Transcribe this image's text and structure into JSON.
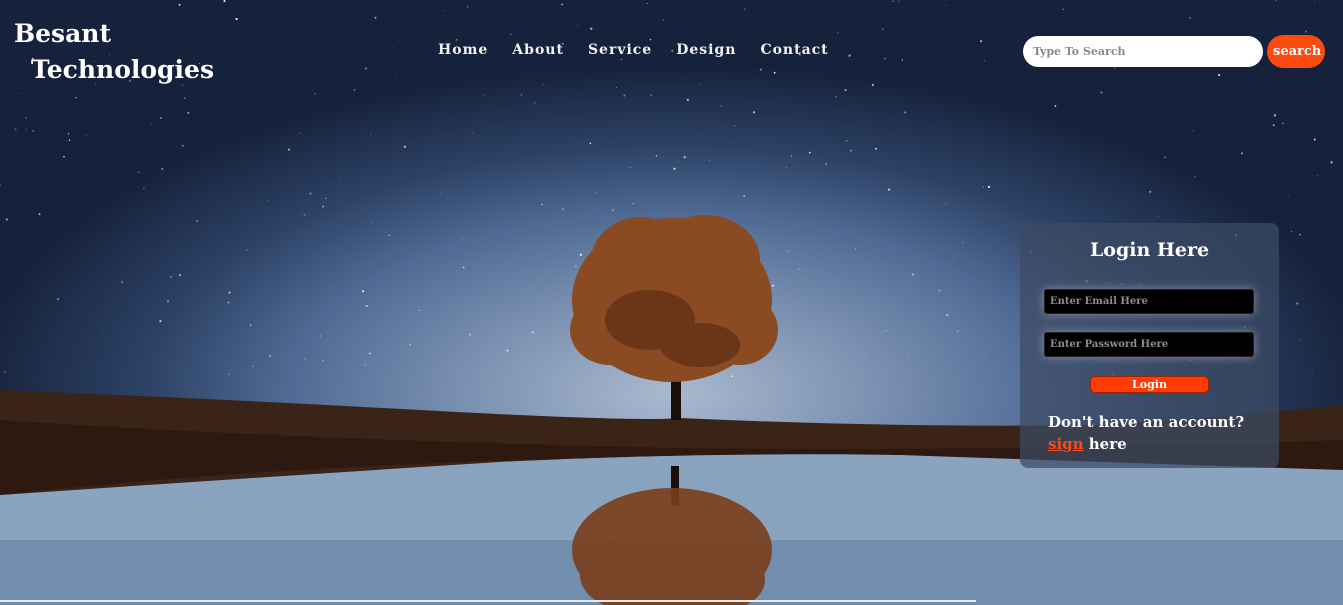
{
  "brand": {
    "line1": "Besant",
    "line2": "Technologies"
  },
  "nav": {
    "items": [
      "Home",
      "About",
      "Service",
      "Design",
      "Contact"
    ]
  },
  "search": {
    "placeholder": "Type To Search",
    "button_label": "search"
  },
  "login": {
    "title": "Login Here",
    "email_placeholder": "Enter Email Here",
    "password_placeholder": "Enter Password Here",
    "button_label": "Login",
    "no_account_text": "Don't have an account?",
    "sign_link": "sign",
    "here_text": "here"
  },
  "colors": {
    "accent": "#ff4a0f",
    "sky": "#4f6a93",
    "card": "#3c4b64"
  }
}
